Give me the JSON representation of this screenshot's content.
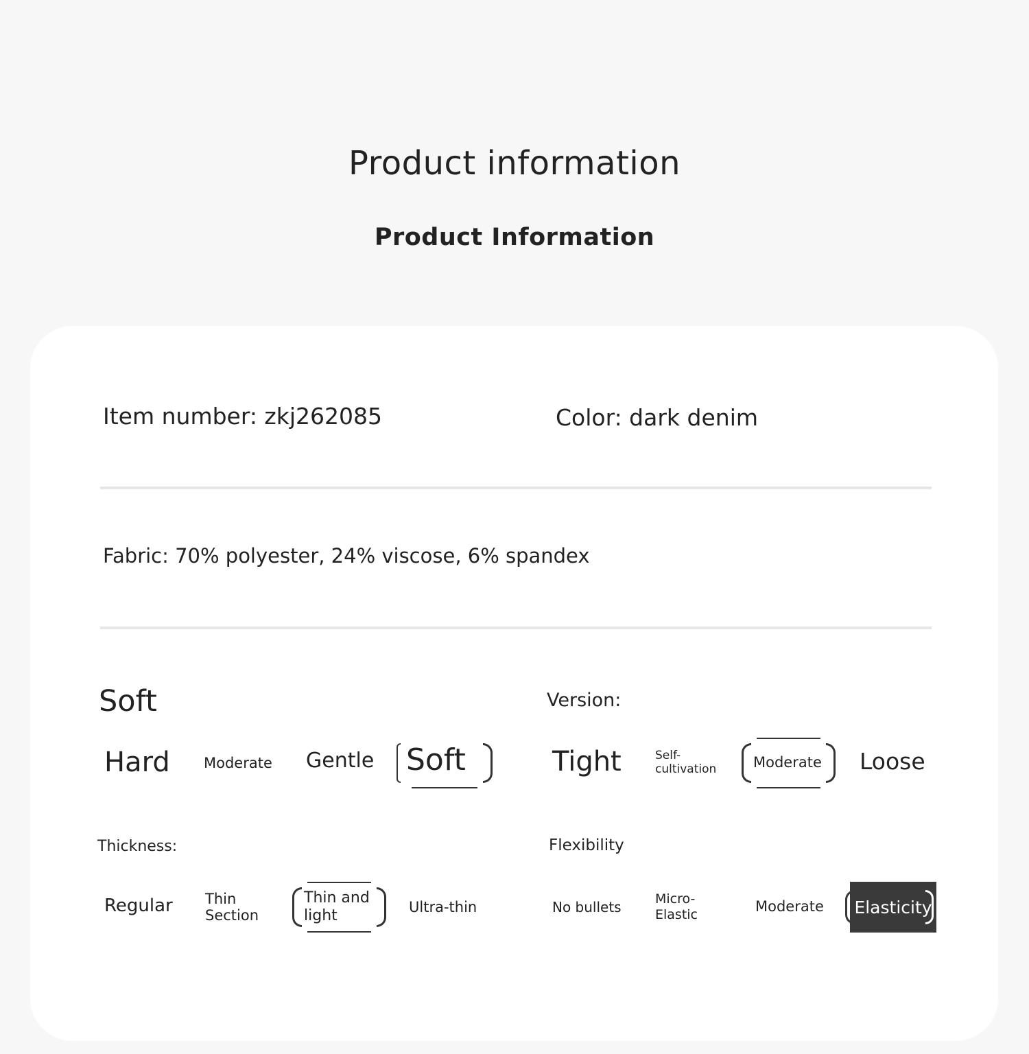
{
  "header": {
    "title": "Product information",
    "subtitle": "Product Information"
  },
  "details": {
    "item_number": "Item number: zkj262085",
    "color": "Color: dark denim",
    "fabric": "Fabric: 70% polyester, 24% viscose, 6% spandex"
  },
  "softness": {
    "label": "Soft",
    "options": [
      "Hard",
      "Moderate",
      "Gentle",
      "Soft"
    ],
    "selected": "Soft"
  },
  "version": {
    "label": "Version:",
    "options": [
      "Tight",
      "Self-cultivation",
      "Moderate",
      "Loose"
    ],
    "selected": "Moderate"
  },
  "thickness": {
    "label": "Thickness:",
    "options": [
      "Regular",
      "Thin Section",
      "Thin and light",
      "Ultra-thin"
    ],
    "selected": "Thin and light"
  },
  "flexibility": {
    "label": "Flexibility",
    "options": [
      "No bullets",
      "Micro-Elastic",
      "Moderate",
      "Elasticity"
    ],
    "selected": "Elasticity"
  },
  "colors": {
    "background": "#f7f7f7",
    "card": "#ffffff",
    "divider": "#e6e6e6",
    "text": "#222222",
    "selected_fill": "#3a3a3a"
  }
}
